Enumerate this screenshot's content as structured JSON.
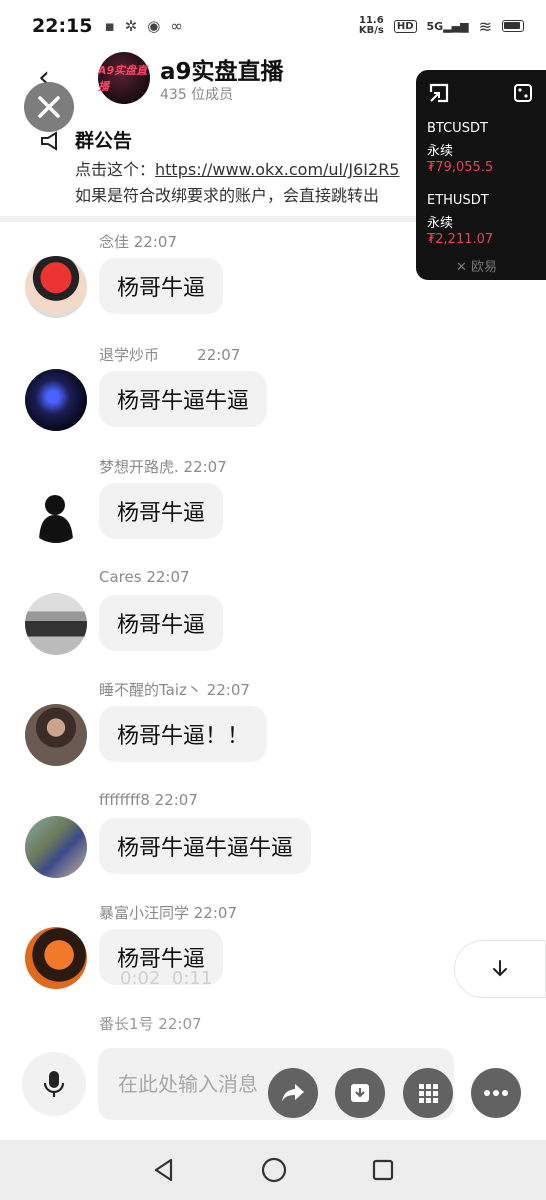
{
  "status_bar": {
    "time": "22:15",
    "net_speed_top": "11.6",
    "net_speed_bottom": "KB/s",
    "hd": "HD",
    "net_type": "5G"
  },
  "header": {
    "group_name": "a9实盘直播",
    "member_count": "435 位成员",
    "avatar_text": "A9实盘直播"
  },
  "announcement": {
    "title": "群公告",
    "line1_prefix": "点击这个：",
    "link": "https://www.okx.com/ul/J6I2R5",
    "line2": "如果是符合改绑要求的账户，会直接跳转出"
  },
  "messages": [
    {
      "name": "念佳 22:07",
      "text": "杨哥牛逼"
    },
    {
      "name": "退学炒币        22:07",
      "text": "杨哥牛逼牛逼"
    },
    {
      "name": "梦想开路虎. 22:07",
      "text": "杨哥牛逼"
    },
    {
      "name": "Cares 22:07",
      "text": "杨哥牛逼"
    },
    {
      "name": "睡不醒的Taiz丶 22:07",
      "text": "杨哥牛逼！！"
    },
    {
      "name": "ffffffff8 22:07",
      "text": "杨哥牛逼牛逼牛逼"
    },
    {
      "name": "暴富小汪同学 22:07",
      "text": "杨哥牛逼"
    },
    {
      "name": "番长1号 22:07",
      "text": ""
    }
  ],
  "price_widget": {
    "items": [
      {
        "symbol": "BTCUSDT",
        "type": "永续",
        "price": "₮79,055.5"
      },
      {
        "symbol": "ETHUSDT",
        "type": "永续",
        "price": "₮2,211.07"
      }
    ],
    "brand": "欧易",
    "price_color": "#e8415a"
  },
  "video": {
    "current": "0:02",
    "total": "0:11"
  },
  "input": {
    "placeholder": "在此处输入消息"
  },
  "icons": {
    "close": "close-icon",
    "back": "back-arrow-icon",
    "mic": "mic-icon",
    "share": "share-icon",
    "download": "download-icon",
    "grid": "grid-icon",
    "more": "more-icon",
    "scroll_down": "arrow-down-icon"
  }
}
